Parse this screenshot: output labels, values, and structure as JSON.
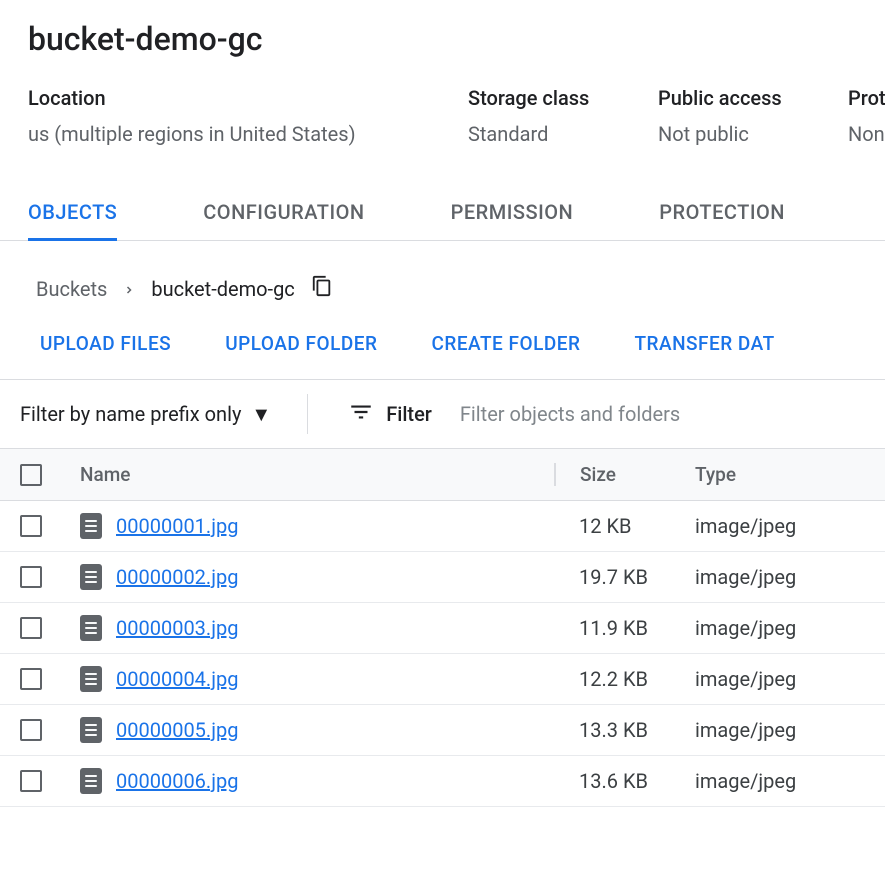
{
  "page_title": "bucket-demo-gc",
  "meta": {
    "location": {
      "label": "Location",
      "value": "us (multiple regions in United States)"
    },
    "storage_class": {
      "label": "Storage class",
      "value": "Standard"
    },
    "public_access": {
      "label": "Public access",
      "value": "Not public"
    },
    "protection": {
      "label": "Protec",
      "value": "None"
    }
  },
  "tabs": {
    "objects": "OBJECTS",
    "configuration": "CONFIGURATION",
    "permission": "PERMISSION",
    "protection": "PROTECTION"
  },
  "breadcrumb": {
    "root": "Buckets",
    "current": "bucket-demo-gc"
  },
  "actions": {
    "upload_files": "UPLOAD FILES",
    "upload_folder": "UPLOAD FOLDER",
    "create_folder": "CREATE FOLDER",
    "transfer_data": "TRANSFER DAT"
  },
  "filter": {
    "dropdown_label": "Filter by name prefix only",
    "label": "Filter",
    "placeholder": "Filter objects and folders"
  },
  "table": {
    "headers": {
      "name": "Name",
      "size": "Size",
      "type": "Type"
    },
    "rows": [
      {
        "name": "00000001.jpg",
        "size": "12 KB",
        "type": "image/jpeg"
      },
      {
        "name": "00000002.jpg",
        "size": "19.7 KB",
        "type": "image/jpeg"
      },
      {
        "name": "00000003.jpg",
        "size": "11.9 KB",
        "type": "image/jpeg"
      },
      {
        "name": "00000004.jpg",
        "size": "12.2 KB",
        "type": "image/jpeg"
      },
      {
        "name": "00000005.jpg",
        "size": "13.3 KB",
        "type": "image/jpeg"
      },
      {
        "name": "00000006.jpg",
        "size": "13.6 KB",
        "type": "image/jpeg"
      }
    ]
  }
}
